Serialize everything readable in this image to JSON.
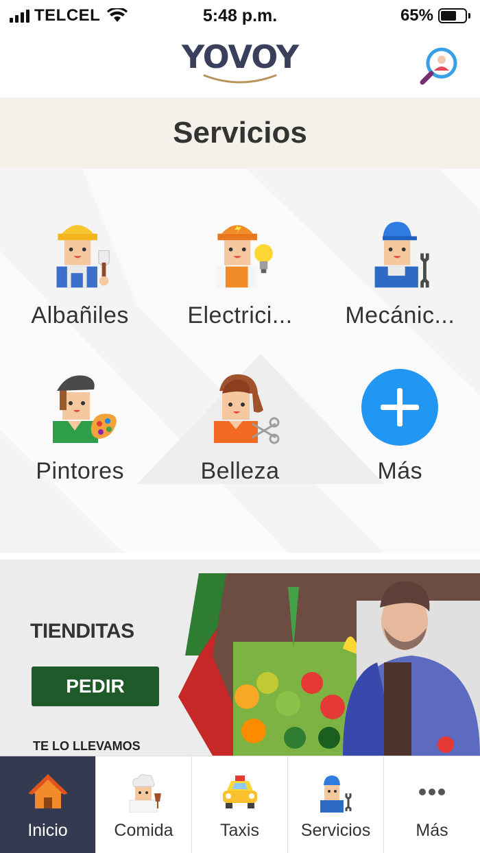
{
  "status_bar": {
    "carrier": "TELCEL",
    "time": "5:48 p.m.",
    "battery": "65%",
    "battery_level": 0.65
  },
  "header": {
    "logo": "YOVOY",
    "search_icon": "user-search-icon"
  },
  "page_title": "Servicios",
  "services": [
    {
      "label": "Albañiles",
      "icon": "bricklayer-icon"
    },
    {
      "label": "Electrici...",
      "icon": "electrician-icon"
    },
    {
      "label": "Mecánic...",
      "icon": "mechanic-icon"
    },
    {
      "label": "Pintores",
      "icon": "painter-icon"
    },
    {
      "label": "Belleza",
      "icon": "stylist-icon"
    },
    {
      "label": "Más",
      "icon": "plus-icon"
    }
  ],
  "banner": {
    "title": "TIENDITAS",
    "button": "PEDIR",
    "subtitle": "TE LO LLEVAMOS"
  },
  "nav": [
    {
      "label": "Inicio",
      "icon": "home-icon",
      "active": true
    },
    {
      "label": "Comida",
      "icon": "chef-icon",
      "active": false
    },
    {
      "label": "Taxis",
      "icon": "taxi-icon",
      "active": false
    },
    {
      "label": "Servicios",
      "icon": "mechanic-icon",
      "active": false
    },
    {
      "label": "Más",
      "icon": "more-dots-icon",
      "active": false
    }
  ],
  "colors": {
    "accent": "#2196f3",
    "nav_active": "#343a4f",
    "banner_button": "#1f5a2a",
    "title_band": "#f4f1eb"
  }
}
